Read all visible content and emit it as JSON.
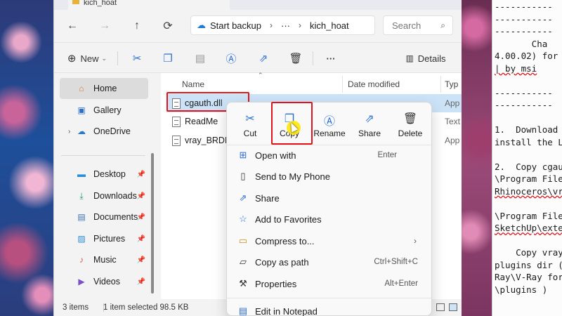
{
  "explorer": {
    "tab_title": "kich_hoat",
    "nav": {
      "back": "←",
      "forward": "→",
      "up": "↑",
      "refresh": "⟳"
    },
    "breadcrumb": {
      "root": "Start backup",
      "more": "···",
      "current": "kich_hoat"
    },
    "search_placeholder": "Search",
    "toolbar": {
      "new_label": "New",
      "more": "···",
      "details_label": "Details"
    },
    "sidebar": {
      "items": [
        {
          "label": "Home",
          "icon": "home-icon"
        },
        {
          "label": "Gallery",
          "icon": "gallery-icon"
        },
        {
          "label": "OneDrive",
          "icon": "cloud-icon"
        },
        {
          "label": "Desktop",
          "icon": "desktop-icon"
        },
        {
          "label": "Downloads",
          "icon": "download-icon"
        },
        {
          "label": "Documents",
          "icon": "documents-icon"
        },
        {
          "label": "Pictures",
          "icon": "pictures-icon"
        },
        {
          "label": "Music",
          "icon": "music-icon"
        },
        {
          "label": "Videos",
          "icon": "videos-icon"
        }
      ]
    },
    "columns": {
      "name": "Name",
      "date": "Date modified",
      "type": "Typ"
    },
    "files": [
      {
        "name": "cgauth.dll",
        "type": "App"
      },
      {
        "name": "ReadMe",
        "type": "Text"
      },
      {
        "name": "vray_BRDFS",
        "type": "App"
      }
    ],
    "status": {
      "count": "3 items",
      "selection": "1 item selected  98.5 KB"
    }
  },
  "context_menu": {
    "quick_actions": [
      "Cut",
      "Copy",
      "Rename",
      "Share",
      "Delete"
    ],
    "items": [
      {
        "label": "Open with",
        "shortcut": "Enter",
        "icon": "open-with-icon"
      },
      {
        "label": "Send to My Phone",
        "shortcut": "",
        "icon": "phone-icon"
      },
      {
        "label": "Share",
        "shortcut": "",
        "icon": "share-icon"
      },
      {
        "label": "Add to Favorites",
        "shortcut": "",
        "icon": "star-icon"
      },
      {
        "label": "Compress to...",
        "shortcut": "",
        "icon": "zip-icon"
      },
      {
        "label": "Copy as path",
        "shortcut": "Ctrl+Shift+C",
        "icon": "path-icon"
      },
      {
        "label": "Properties",
        "shortcut": "Alt+Enter",
        "icon": "wrench-icon"
      },
      {
        "label": "Edit in Notepad",
        "shortcut": "",
        "icon": "notepad-icon"
      }
    ]
  },
  "notepad": {
    "lines": [
      "-----------",
      "-----------",
      "-----------",
      "       Cha",
      "4.00.02) for",
      "| by msi",
      "",
      "-----------",
      "-----------",
      "",
      "1.  Download",
      "install the L",
      "",
      "2.  Copy cgau",
      "\\Program File",
      "Rhinoceros\\vr",
      "",
      "\\Program File",
      "SketchUp\\exte",
      "",
      "    Copy vray",
      "plugins dir (",
      "Ray\\V-Ray for",
      "\\plugins )"
    ]
  }
}
